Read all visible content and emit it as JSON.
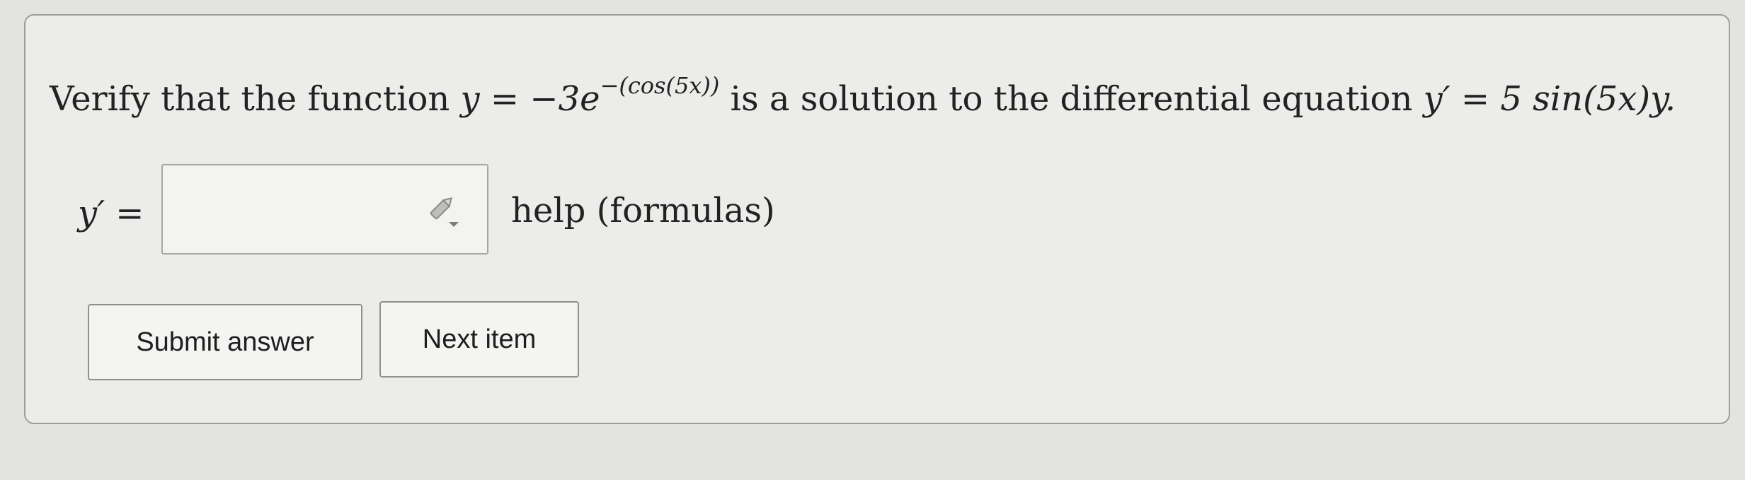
{
  "problem": {
    "prefix": "Verify that the function ",
    "y_var": "y",
    "eq1": " = −3",
    "base": "e",
    "exponent": "−(cos(5x))",
    "middle": " is a solution to the differential equation ",
    "yprime": "y′",
    "eq2": " = 5 sin(5x)y."
  },
  "answer": {
    "label": "y′ =",
    "value": "",
    "placeholder": ""
  },
  "help_label": "help (formulas)",
  "buttons": {
    "submit": "Submit answer",
    "next": "Next item"
  },
  "icons": {
    "edit": "pencil-edit-icon"
  }
}
